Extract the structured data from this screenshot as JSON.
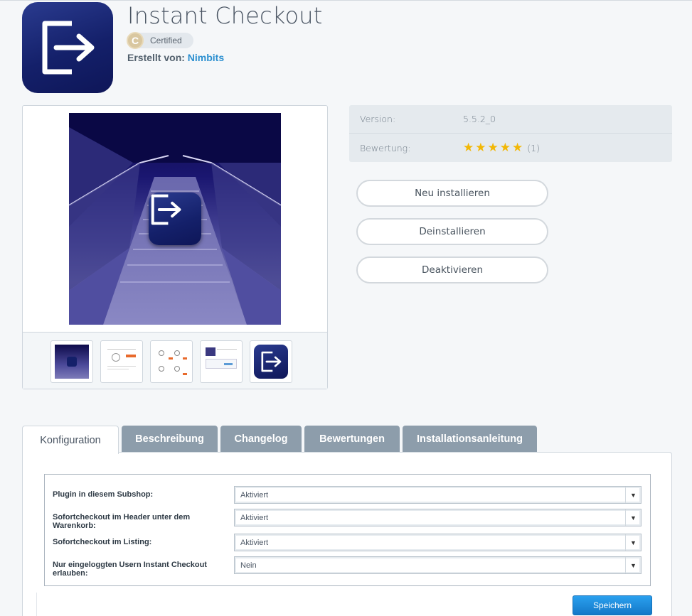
{
  "plugin": {
    "title": "Instant Checkout",
    "certified_label": "Certified",
    "author_prefix": "Erstellt von:",
    "author_name": "Nimbits",
    "icon": "exit-arrow-icon",
    "brand_color": "#14206a"
  },
  "gallery": {
    "main_image": "staircase-with-checkout-icon",
    "thumbnails": [
      {
        "name": "thumb-staircase"
      },
      {
        "name": "thumb-product-page"
      },
      {
        "name": "thumb-product-listing"
      },
      {
        "name": "thumb-shop-screenshot"
      },
      {
        "name": "thumb-app-icon"
      }
    ]
  },
  "info": {
    "version_label": "Version:",
    "version_value": "5.5.2_0",
    "rating_label": "Bewertung:",
    "rating_stars": 5,
    "rating_count": "(1)"
  },
  "actions": {
    "reinstall": "Neu installieren",
    "uninstall": "Deinstallieren",
    "deactivate": "Deaktivieren"
  },
  "tabs": [
    {
      "label": "Konfiguration",
      "active": true
    },
    {
      "label": "Beschreibung",
      "active": false
    },
    {
      "label": "Changelog",
      "active": false
    },
    {
      "label": "Bewertungen",
      "active": false
    },
    {
      "label": "Installationsanleitung",
      "active": false
    }
  ],
  "config": {
    "rows": [
      {
        "label": "Plugin in diesem Subshop:",
        "value": "Aktiviert"
      },
      {
        "label": "Sofortcheckout im Header unter dem Warenkorb:",
        "value": "Aktiviert"
      },
      {
        "label": "Sofortcheckout im Listing:",
        "value": "Aktiviert"
      },
      {
        "label": "Nur eingeloggten Usern Instant Checkout erlauben:",
        "value": "Nein"
      }
    ],
    "save_label": "Speichern"
  }
}
